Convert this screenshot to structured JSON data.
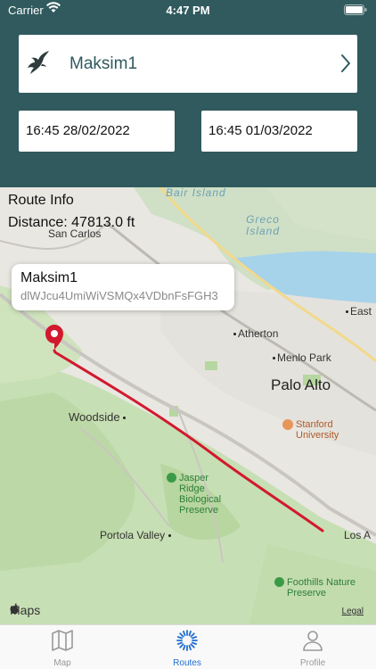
{
  "status_bar": {
    "carrier": "Carrier",
    "time": "4:47 PM"
  },
  "header": {
    "user_name": "Maksim1",
    "start_date": "16:45  28/02/2022",
    "end_date": "16:45  01/03/2022",
    "background_color": "#305a5e"
  },
  "map": {
    "route_info_title": "Route Info",
    "distance": "Distance: 47813.0 ft",
    "callout": {
      "title": "Maksim1",
      "subtitle": "dlWJcu4UmiWiVSMQx4VDbnFsFGH3"
    },
    "labels": {
      "san_carlos": "San Carlos",
      "bair_island": "Bair Island",
      "greco_island": "Greco Island",
      "east": "East",
      "atherton": "Atherton",
      "menlo_park": "Menlo Park",
      "palo_alto": "Palo Alto",
      "stanford": "Stanford University",
      "woodside": "Woodside",
      "jasper_ridge": "Jasper Ridge Biological Preserve",
      "portola_valley": "Portola Valley",
      "los_altos": "Los A",
      "foothills": "Foothills Nature Preserve"
    },
    "maps_logo": "Maps",
    "legal": "Legal",
    "route_color": "#d2192e"
  },
  "tabs": [
    {
      "label": "Map",
      "icon": "map-icon",
      "active": false
    },
    {
      "label": "Routes",
      "icon": "routes-icon",
      "active": true
    },
    {
      "label": "Profile",
      "icon": "profile-icon",
      "active": false
    }
  ]
}
